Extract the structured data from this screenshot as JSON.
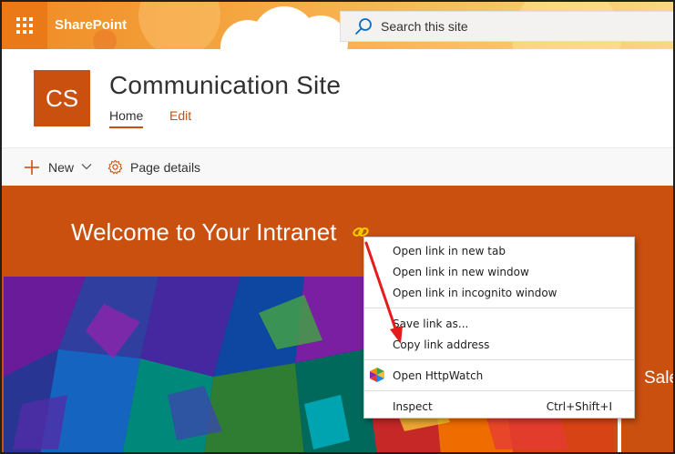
{
  "suite_bar": {
    "app_name": "SharePoint",
    "search_placeholder": "Search this site",
    "icons": [
      "app-launcher-icon",
      "search-icon"
    ]
  },
  "site_header": {
    "logo_initials": "CS",
    "site_title": "Communication Site",
    "nav": [
      {
        "label": "Home",
        "active": true
      },
      {
        "label": "Edit",
        "active": false
      }
    ]
  },
  "command_bar": {
    "new_label": "New",
    "page_details_label": "Page details",
    "icons": [
      "plus-icon",
      "chevron-down-icon",
      "gear-icon"
    ]
  },
  "hero": {
    "title": "Welcome to Your Intranet",
    "side_tile_label": "Sales",
    "icons": [
      "link-icon"
    ]
  },
  "context_menu": {
    "items": [
      {
        "label": "Open link in new tab"
      },
      {
        "label": "Open link in new window"
      },
      {
        "label": "Open link in incognito window"
      },
      {
        "label": "Save link as..."
      },
      {
        "label": "Copy link address",
        "highlighted": true
      },
      {
        "label": "Open HttpWatch",
        "icon": "httpwatch-icon"
      },
      {
        "label": "Inspect",
        "shortcut": "Ctrl+Shift+I"
      }
    ]
  },
  "colors": {
    "accent": "#ca5010",
    "suite_bar_orange": "#f08a24",
    "highlight_yellow": "#fbfb8e",
    "annotation_arrow": "#e51c1c"
  }
}
